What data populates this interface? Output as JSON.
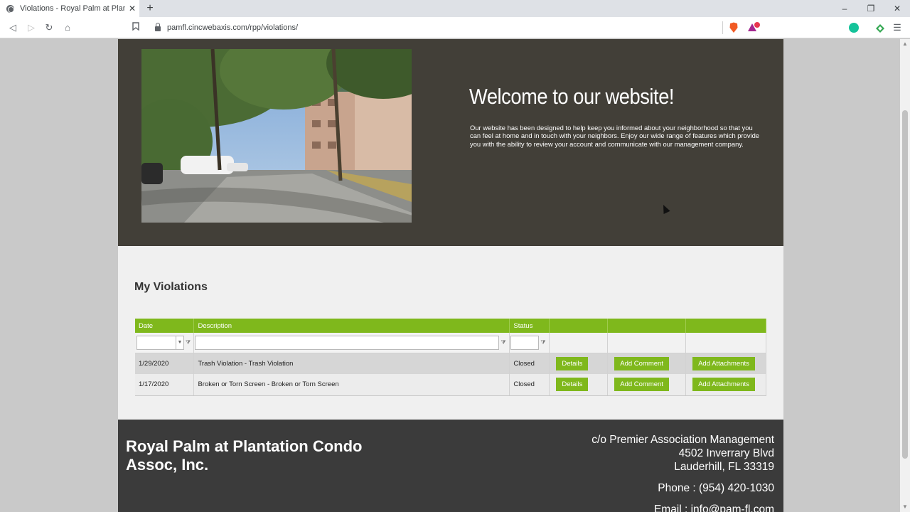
{
  "browser": {
    "tab_title": "Violations - Royal Palm at Plantatio",
    "url": "pamfl.cincwebaxis.com/rpp/violations/",
    "window_controls": [
      "–",
      "❐",
      "✕"
    ]
  },
  "hero": {
    "welcome_title": "Welcome to our website!",
    "welcome_text": "Our website has been designed to help keep you informed about your neighborhood so that you can feel at home and in touch with your neighbors. Enjoy our wide range of features which provide you with the ability to review your account and communicate with our management company."
  },
  "violations": {
    "title": "My Violations",
    "columns": [
      "Date",
      "Description",
      "Status",
      "",
      "",
      ""
    ],
    "rows": [
      {
        "date": "1/29/2020",
        "description": "Trash Violation - Trash Violation",
        "status": "Closed",
        "details": "Details",
        "comment": "Add Comment",
        "attachments": "Add Attachments"
      },
      {
        "date": "1/17/2020",
        "description": "Broken or Torn Screen - Broken or Torn Screen",
        "status": "Closed",
        "details": "Details",
        "comment": "Add Comment",
        "attachments": "Add Attachments"
      }
    ]
  },
  "footer": {
    "assoc_name": "Royal Palm at Plantation Condo Assoc, Inc.",
    "address_line1": "c/o Premier Association Management",
    "address_line2": "4502 Inverrary Blvd",
    "address_line3": "Lauderhill, FL 33319",
    "phone": "Phone : (954) 420-1030",
    "email": "Email : info@pam-fl.com"
  },
  "colors": {
    "accent_green": "#7fb81c",
    "hero_bg": "#423f38",
    "footer_bg": "#3b3b3b"
  }
}
